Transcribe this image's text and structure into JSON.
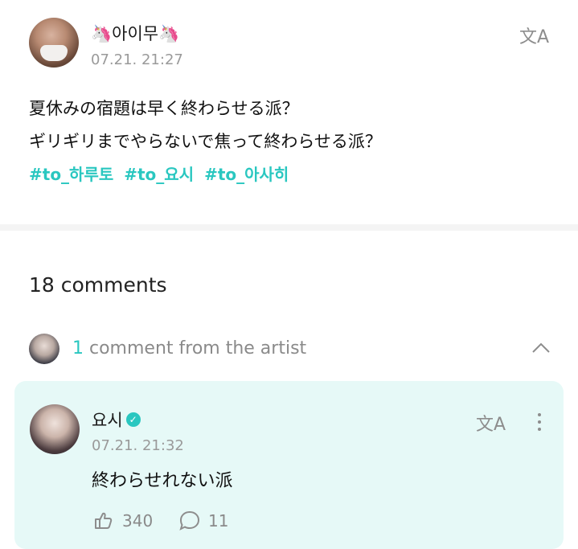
{
  "post": {
    "author": "🦄아이무🦄",
    "timestamp": "07.21. 21:27",
    "lines": [
      "夏休みの宿題は早く終わらせる派？",
      "ギリギリまでやらないで焦って終わらせる派？"
    ],
    "hashtags": [
      "#to_하루토",
      "#to_요시",
      "#to_아사히"
    ],
    "translate_label": "文A"
  },
  "comments": {
    "count_label": "18 comments",
    "artist_count": "1",
    "artist_label": "comment from the artist"
  },
  "artist_comment": {
    "author": "요시",
    "timestamp": "07.21. 21:32",
    "text": "終わらせれない派",
    "likes": "340",
    "replies": "11",
    "translate_label": "文A"
  },
  "colors": {
    "accent": "#2ac7c0",
    "card_bg": "#e6f9f7"
  }
}
